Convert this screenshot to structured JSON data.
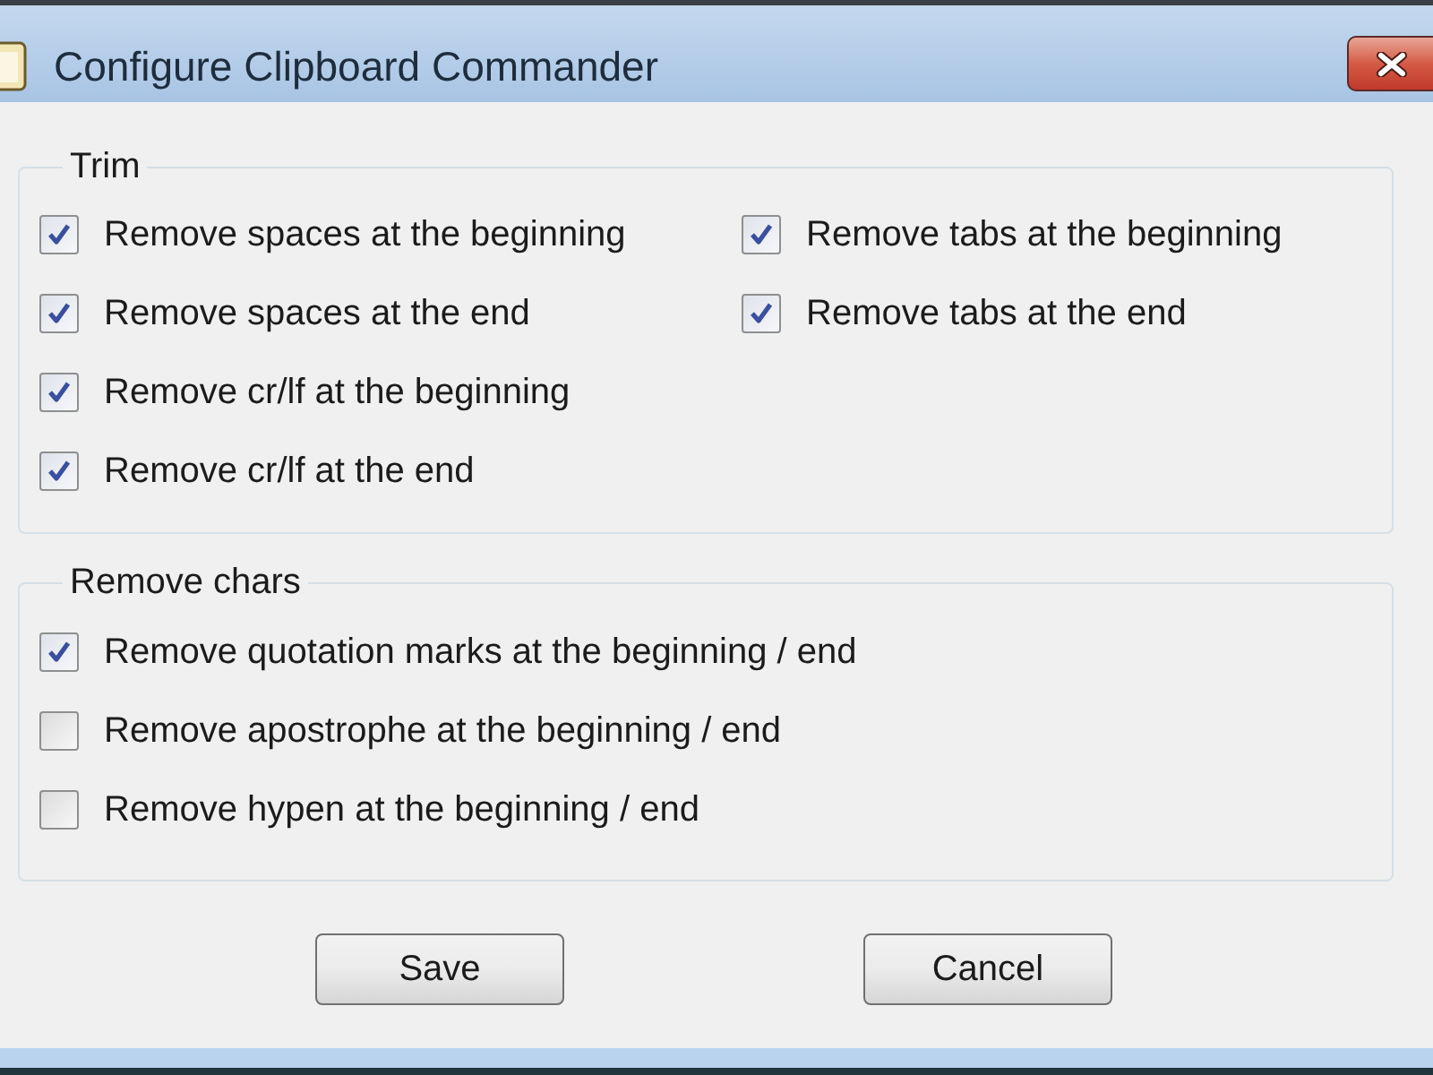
{
  "window": {
    "title": "Configure Clipboard Commander"
  },
  "groups": [
    {
      "legend": "Trim",
      "columns": [
        {
          "options": [
            {
              "label": "Remove spaces at the beginning",
              "checked": true
            },
            {
              "label": "Remove spaces at the end",
              "checked": true
            },
            {
              "label": "Remove cr/lf at the beginning",
              "checked": true
            },
            {
              "label": "Remove cr/lf at the end",
              "checked": true
            }
          ]
        },
        {
          "options": [
            {
              "label": "Remove tabs at the beginning",
              "checked": true
            },
            {
              "label": "Remove tabs at the end",
              "checked": true
            }
          ]
        }
      ]
    },
    {
      "legend": "Remove chars",
      "columns": [
        {
          "options": [
            {
              "label": "Remove quotation marks at the beginning / end",
              "checked": true
            },
            {
              "label": "Remove apostrophe at the beginning / end",
              "checked": false
            },
            {
              "label": "Remove hypen at the beginning / end",
              "checked": false
            }
          ]
        }
      ]
    }
  ],
  "buttons": [
    {
      "label": "Save"
    },
    {
      "label": "Cancel"
    }
  ]
}
